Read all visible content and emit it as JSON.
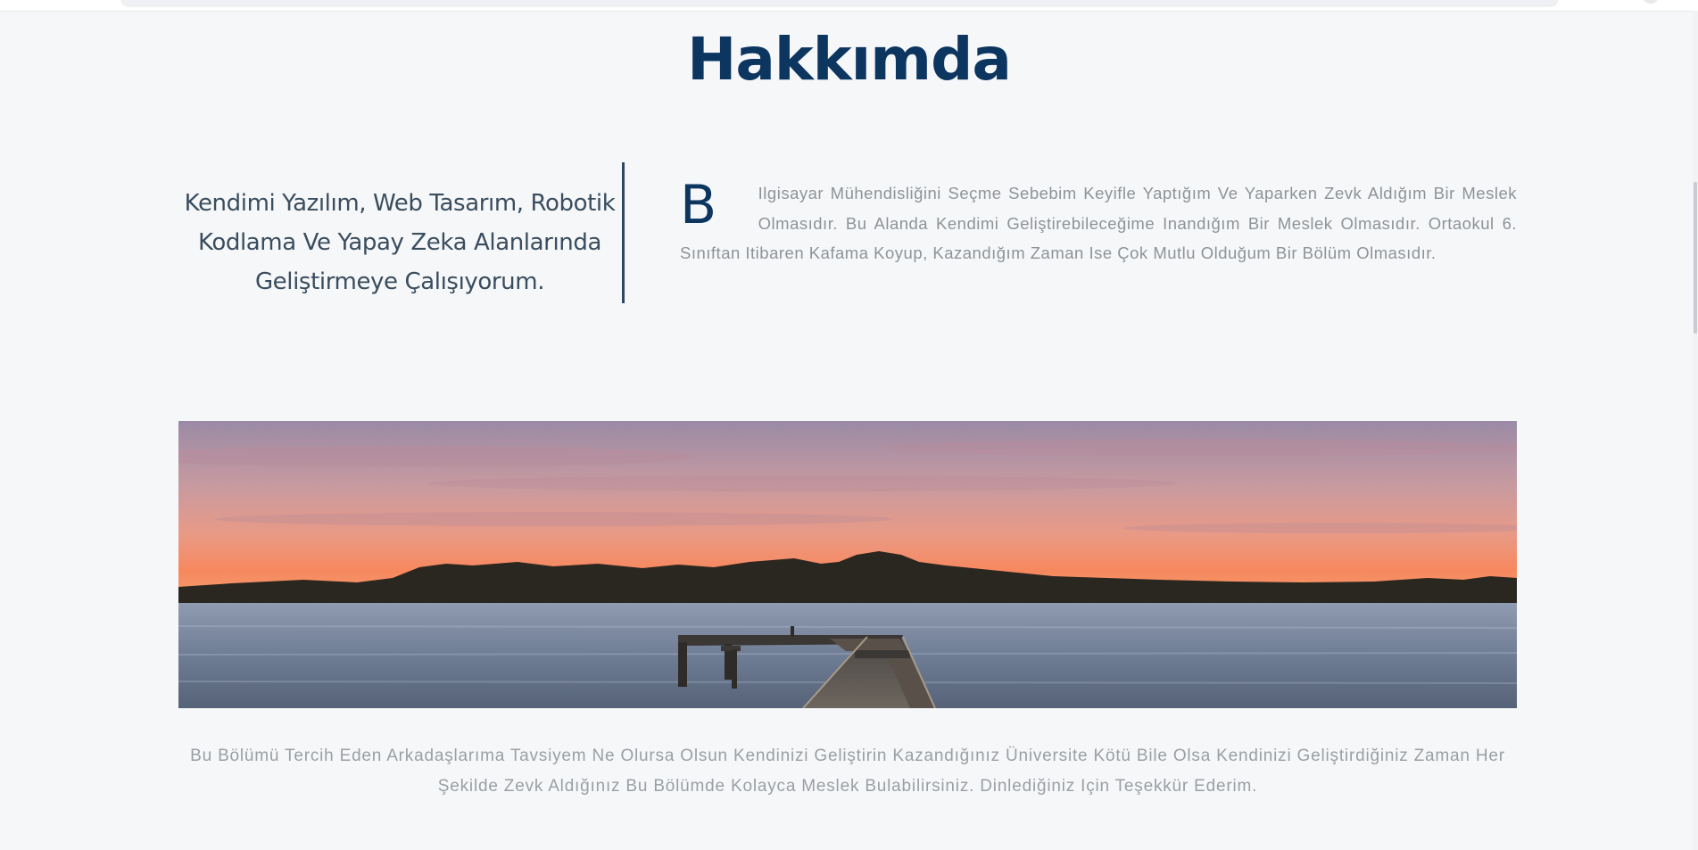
{
  "about": {
    "title": "Hakkımda",
    "tagline": "Kendimi Yazılım, Web Tasarım, Robotik Kodlama Ve Yapay Zeka Alanlarında Geliştirmeye Çalışıyorum.",
    "intro_dropcap": "B",
    "intro_text": "Ilgisayar Mühendisliğini Seçme Sebebim Keyifle Yaptığım Ve Yaparken Zevk Aldığım Bir Meslek Olmasıdır. Bu Alanda Kendimi Geliştirebileceğime Inandığım Bir Meslek Olmasıdır. Ortaokul 6. Sınıftan Itibaren Kafama Koyup, Kazandığım Zaman Ise Çok Mutlu Olduğum Bir Bölüm Olmasıdır.",
    "closing_text": "Bu Bölümü Tercih Eden Arkadaşlarıma Tavsiyem Ne Olursa Olsun Kendinizi Geliştirin Kazandığınız Üniversite Kötü Bile Olsa Kendinizi Geliştirdiğiniz Zaman Her Şekilde Zevk Aldığınız Bu Bölümde Kolayca Meslek Bulabilirsiniz. Dinlediğiniz Için Teşekkür Ederim."
  },
  "colors": {
    "background": "#f6f7f9",
    "heading": "#0c3560",
    "tagline": "#3a4d5e",
    "body_text": "#8d9397",
    "divider": "#2d4863"
  }
}
